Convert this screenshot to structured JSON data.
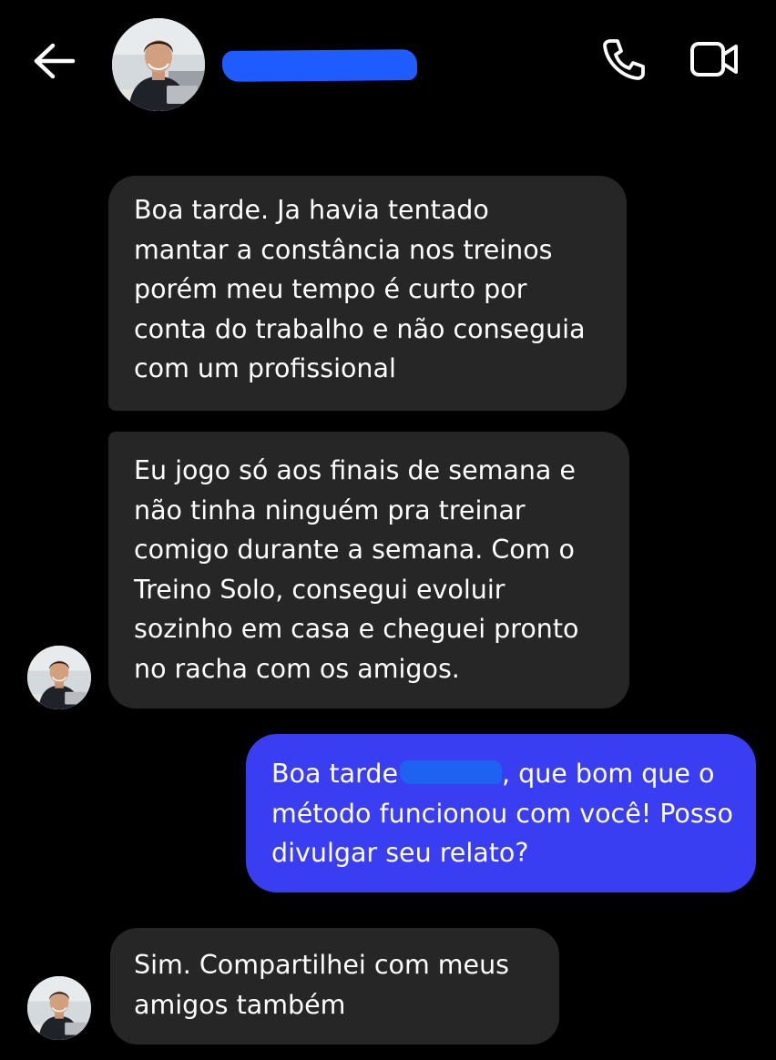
{
  "header": {
    "back_icon": "arrow-left-icon",
    "contact_name_redacted": true,
    "call_icon": "phone-icon",
    "video_icon": "video-camera-icon"
  },
  "colors": {
    "background": "#000000",
    "incoming_bubble": "#262626",
    "outgoing_bubble": "#3a3ef2",
    "redaction": "#1e5cff"
  },
  "messages": [
    {
      "direction": "incoming",
      "lines": [
        "Boa tarde. Ja havia tentado",
        "mantar a constância nos treinos",
        "porém meu tempo é curto por",
        "conta do trabalho e não conseguia",
        "com um profissional"
      ]
    },
    {
      "direction": "incoming",
      "lines": [
        "Eu jogo só aos finais de semana e",
        "não tinha ninguém pra treinar",
        "comigo durante a semana. Com o",
        "Treino Solo, consegui evoluir",
        "sozinho em casa e cheguei pronto",
        "no racha com os amigos."
      ]
    },
    {
      "direction": "outgoing",
      "line1_before": "Boa tarde",
      "line1_after": ", que bom que o",
      "lines_rest": [
        "método funcionou com você! Posso",
        "divulgar seu relato?"
      ]
    },
    {
      "direction": "incoming",
      "lines": [
        "Sim. Compartilhei com meus",
        "amigos também"
      ]
    }
  ]
}
